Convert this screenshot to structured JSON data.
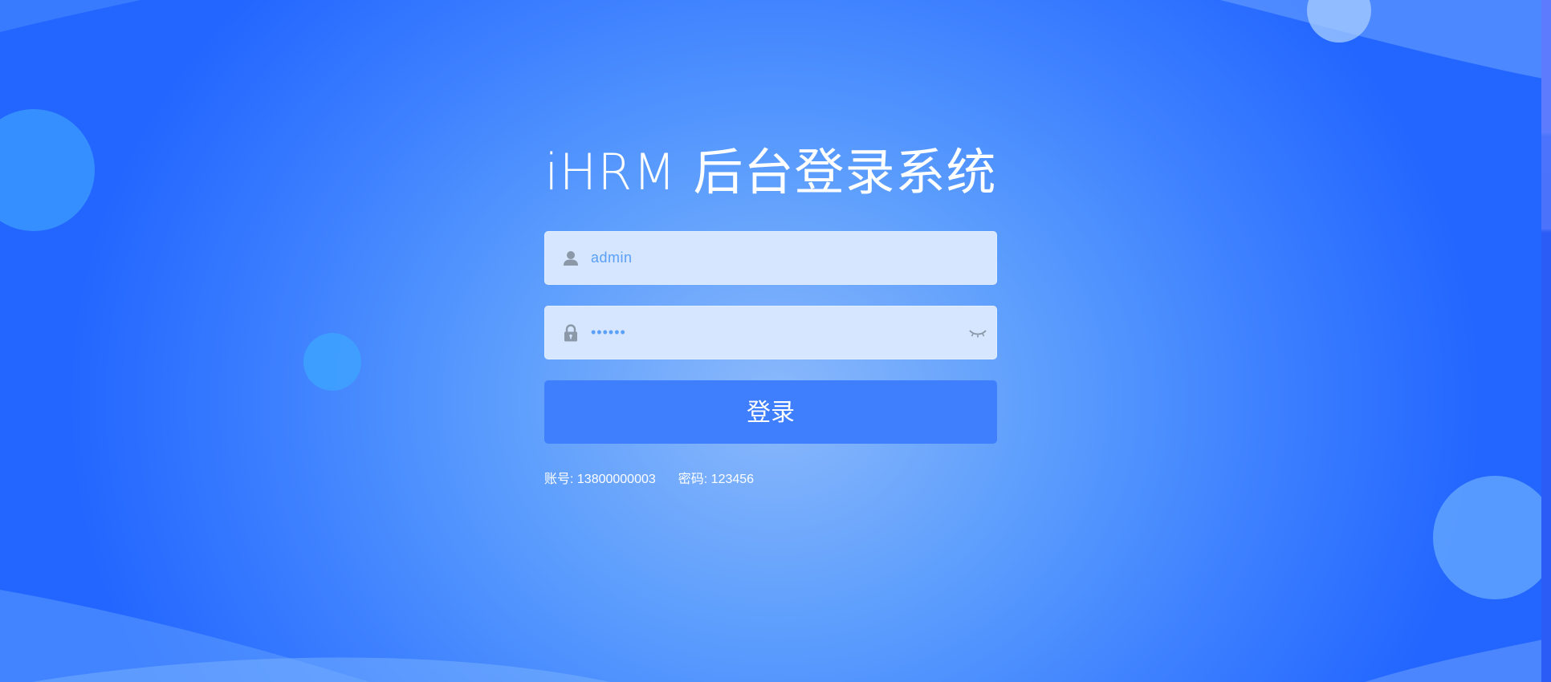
{
  "title": "iHRM 后台登录系统",
  "login_form": {
    "username": {
      "value": "admin",
      "icon": "user-icon"
    },
    "password": {
      "value": "••••••",
      "icon": "lock-icon",
      "toggle_icon": "eye-closed-icon"
    },
    "submit_label": "登录"
  },
  "hint": {
    "account": "账号: 13800000003",
    "password": "密码: 123456"
  },
  "colors": {
    "background_center": "#8bb9fb",
    "background_edge": "#2366ff",
    "button": "#3f7ffe",
    "input_bg": "#d6e6fe",
    "input_text": "#5aa0f8"
  }
}
